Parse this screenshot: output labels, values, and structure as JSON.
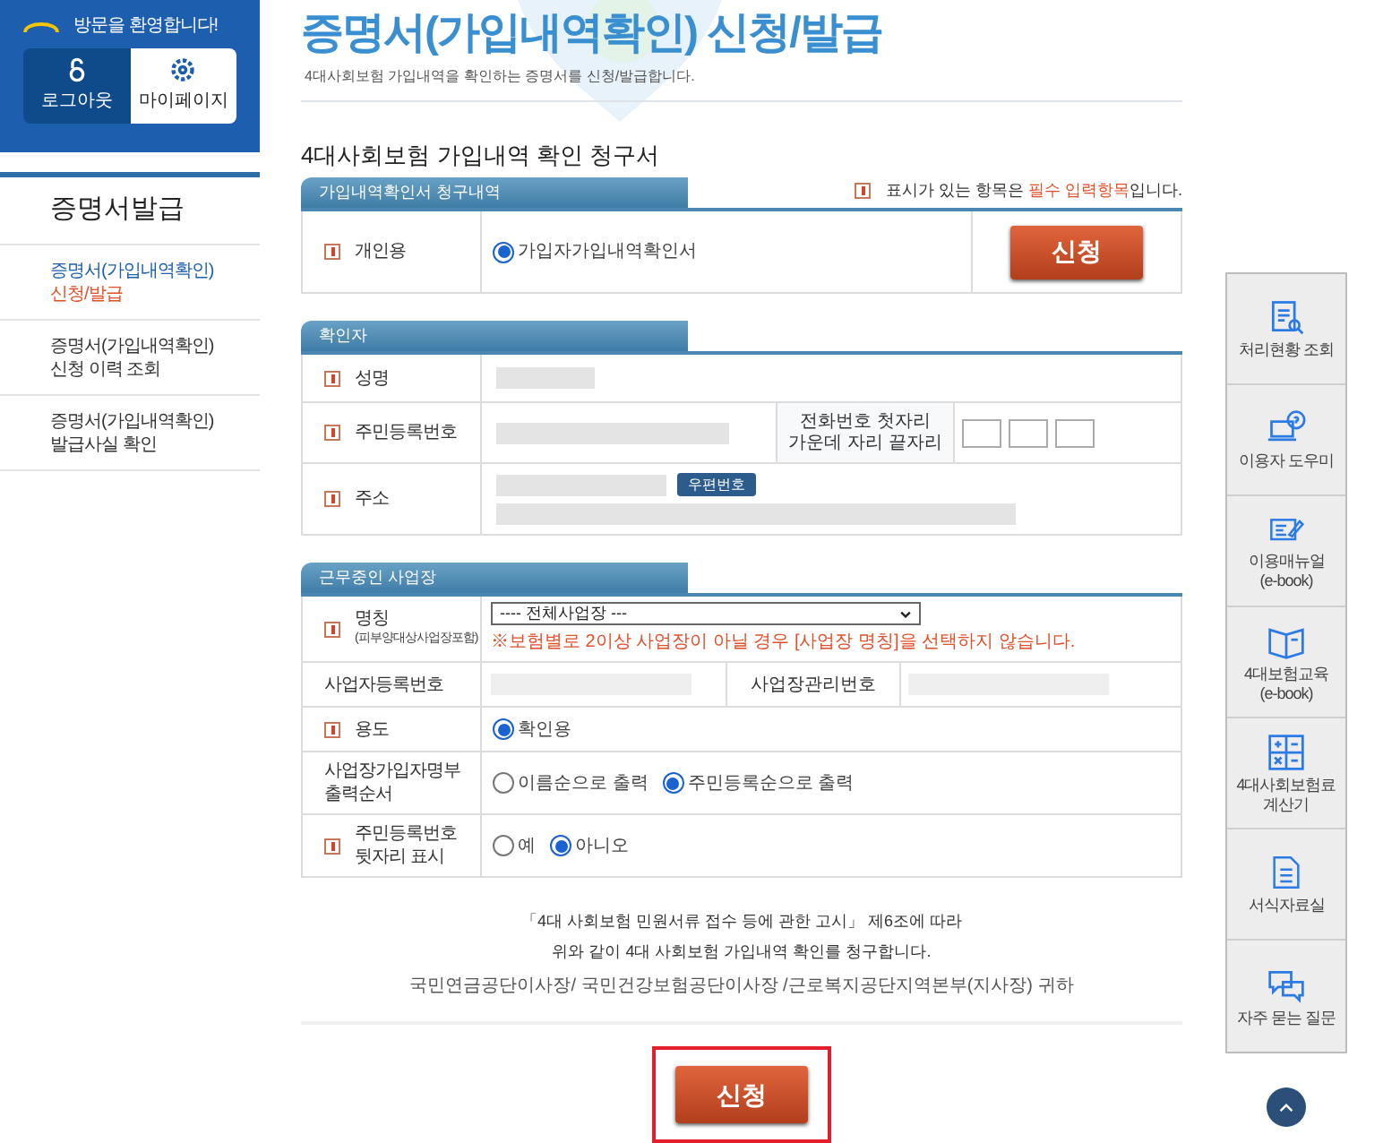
{
  "user_panel": {
    "greeting": "방문을 환영합니다!",
    "buttons": [
      {
        "label": "로그아웃"
      },
      {
        "label": "마이페이지"
      }
    ]
  },
  "sidebar": {
    "title": "증명서발급",
    "items": [
      {
        "lines": [
          "증명서(가입내역확인)",
          "신청/발급"
        ],
        "selected": true
      },
      {
        "lines": [
          "증명서(가입내역확인)",
          "신청 이력 조회"
        ],
        "selected": false
      },
      {
        "lines": [
          "증명서(가입내역확인)",
          "발급사실 확인"
        ],
        "selected": false
      }
    ]
  },
  "page": {
    "title": "증명서(가입내역확인) 신청/발급",
    "subtitle": "4대사회보험 가입내역을 확인하는 증명서를 신청/발급합니다."
  },
  "form_title": "4대사회보험 가입내역 확인 청구서",
  "required_note": {
    "before": "표시가 있는 항목은 ",
    "emphasis": "필수 입력항목",
    "after": "입니다."
  },
  "sections": [
    {
      "title": "가입내역확인서 청구내역",
      "rows": [
        {
          "kind": "radio",
          "label": "개인용",
          "required": true,
          "options": [
            {
              "label": "가입자가입내역확인서",
              "selected": true
            }
          ],
          "action": "신청"
        }
      ]
    },
    {
      "title": "확인자",
      "rows": [
        {
          "kind": "masked",
          "label": "성명",
          "required": true
        },
        {
          "kind": "phone",
          "label": "주민등록번호",
          "required": true,
          "side_label": [
            "전화번호 첫자리",
            "가운데 자리 끝자리"
          ]
        },
        {
          "kind": "address",
          "label": "주소",
          "required": true,
          "button": "우편번호"
        }
      ]
    },
    {
      "title": "근무중인 사업장",
      "rows": [
        {
          "kind": "select",
          "label": "명칭",
          "sublabel": "(피부양대상사업장포함)",
          "required": true,
          "value": "---- 전체사업장 ---",
          "note": "※보험별로 2이상 사업장이 아닐 경우 [사업장 명칭]을 선택하지 않습니다."
        },
        {
          "kind": "pair",
          "label": "사업자등록번호",
          "required": false,
          "side_label": [
            "사업장관리번호"
          ]
        },
        {
          "kind": "radio",
          "label": "용도",
          "required": true,
          "options": [
            {
              "label": "확인용",
              "selected": true
            }
          ]
        },
        {
          "kind": "radio",
          "label": "사업장가입자명부 출력순서",
          "required": false,
          "options": [
            {
              "label": "이름순으로 출력",
              "selected": false
            },
            {
              "label": "주민등록순으로 출력",
              "selected": true
            }
          ]
        },
        {
          "kind": "radio",
          "label": "주민등록번호 뒷자리 표시",
          "required": true,
          "options": [
            {
              "label": "예",
              "selected": false
            },
            {
              "label": "아니오",
              "selected": true
            }
          ]
        }
      ]
    }
  ],
  "statement": [
    "「4대 사회보험 민원서류 접수 등에 관한 고시」 제6조에 따라",
    "위와 같이 4대 사회보험 가입내역 확인를 청구합니다."
  ],
  "addressee": "국민연금공단이사장/ 국민건강보험공단이사장 /근로복지공단지역본부(지사장) 귀하",
  "submit": {
    "label": "신청",
    "highlighted": true
  },
  "quick_menu": [
    {
      "lines": [
        "처리현황 조회"
      ]
    },
    {
      "lines": [
        "이용자 도우미"
      ]
    },
    {
      "lines": [
        "이용매뉴얼",
        "(e-book)"
      ]
    },
    {
      "lines": [
        "4대보험교육",
        "(e-book)"
      ]
    },
    {
      "lines": [
        "4대사회보험료",
        "계산기"
      ]
    },
    {
      "lines": [
        "서식자료실"
      ]
    },
    {
      "lines": [
        "자주 묻는 질문"
      ]
    }
  ]
}
